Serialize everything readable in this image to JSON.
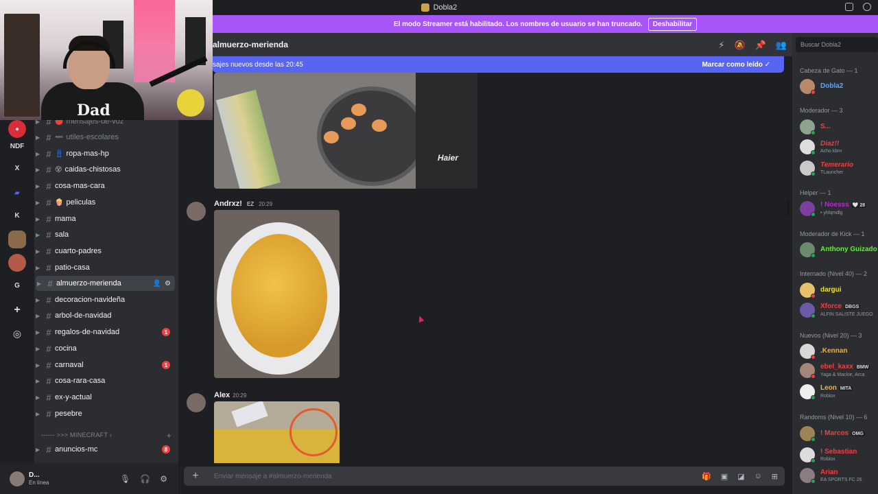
{
  "window": {
    "title": "Dobla2"
  },
  "streamer_banner": {
    "message": "El modo Streamer está habilitado. Los nombres de usuario se han truncado.",
    "button": "Deshabilitar"
  },
  "webcam": {
    "shirt_text": "Dad"
  },
  "servers": [
    "NDF",
    "X",
    "K",
    "G"
  ],
  "channels": {
    "items": [
      {
        "emoji": "🔴",
        "label": "mensajes-de-voz",
        "muted": true
      },
      {
        "emoji": "➖",
        "label": "utiles-escolares",
        "muted": true
      },
      {
        "emoji": "👖",
        "label": "ropa-mas-hp"
      },
      {
        "emoji": "😵",
        "label": "caidas-chistosas"
      },
      {
        "label": "cosa-mas-cara"
      },
      {
        "emoji": "🍿",
        "label": "peliculas"
      },
      {
        "label": "mama"
      },
      {
        "label": "sala"
      },
      {
        "label": "cuarto-padres"
      },
      {
        "label": "patio-casa"
      },
      {
        "label": "almuerzo-merienda",
        "active": true
      },
      {
        "label": "decoracion-navideña"
      },
      {
        "label": "arbol-de-navidad"
      },
      {
        "label": "regalos-de-navidad",
        "badge": "1"
      },
      {
        "label": "cocina"
      },
      {
        "label": "carnaval",
        "badge": "1"
      },
      {
        "label": "cosa-rara-casa"
      },
      {
        "label": "ex-y-actual"
      },
      {
        "label": "pesebre"
      }
    ],
    "category": "------ >>> MINECRAFT",
    "minecraft_channel": {
      "label": "anuncios-mc",
      "badge": "8"
    }
  },
  "user": {
    "name": "D...",
    "status": "En línea"
  },
  "chat": {
    "channel_name": "almuerzo-merienda",
    "new_messages_text": "sajes nuevos desde las 20:45",
    "mark_read": "Marcar como leído",
    "image1_brand": "Haier",
    "messages": [
      {
        "author": "Andrxz!",
        "tag": "EZ",
        "time": "20:29"
      },
      {
        "author": "Alex",
        "time": "20:29"
      }
    ],
    "composer_placeholder": "Enviar mensaje a #almuerzo-merienda"
  },
  "members": {
    "search_placeholder": "Buscar Dobla2",
    "groups": [
      {
        "title": "Cabeza de Gato — 1",
        "members": [
          {
            "name": "Dobla2",
            "color": "#5aa6ff"
          }
        ]
      },
      {
        "title": "Moderador — 3",
        "members": [
          {
            "name": "S...",
            "color": "#f23f43"
          },
          {
            "name": "Diaz!!",
            "color": "#f23f43",
            "sub": "Acho kbrn"
          },
          {
            "name": "Temerario",
            "color": "#f23f43",
            "sub": "TLauncher"
          }
        ]
      },
      {
        "title": "Helper — 1",
        "members": [
          {
            "name": "! Noesss",
            "color": "#c026d3",
            "tag": "🤍 28",
            "sub": "• yhlqmdlg"
          }
        ]
      },
      {
        "title": "Moderador de Kick — 1",
        "members": [
          {
            "name": "Anthony Guizado",
            "color": "#53fc18"
          }
        ]
      },
      {
        "title": "Internado (Nivel 40) — 2",
        "members": [
          {
            "name": "dargui",
            "color": "#f0e130"
          },
          {
            "name": "Xforce",
            "color": "#f23f43",
            "tag": "DBGS",
            "sub": "ALFIN SALISTE JUEGO"
          }
        ]
      },
      {
        "title": "Nuevos (Nivel 20) — 3",
        "members": [
          {
            "name": ".Kennan",
            "color": "#f2b040"
          },
          {
            "name": "ebel_kaxx",
            "color": "#f23f43",
            "tag": "BMW",
            "sub": "Yaga & Mackie, Arca"
          },
          {
            "name": "Leon",
            "color": "#f2b040",
            "tag": "MITA",
            "sub": "Roblox"
          }
        ]
      },
      {
        "title": "Randoms (Nivel 10) — 6",
        "members": [
          {
            "name": "! Marcos",
            "color": "#f23f43",
            "tag": "OMG",
            "sub": ""
          },
          {
            "name": "! Sebastian",
            "color": "#f23f43",
            "sub": "Roblox"
          },
          {
            "name": "Arian",
            "color": "#f23f43",
            "sub": "EA SPORTS FC 26"
          }
        ]
      }
    ]
  },
  "colors": {
    "accent": "#5865f2",
    "streamer": "#a855f7",
    "badge": "#f23f43",
    "online": "#23a55a"
  }
}
